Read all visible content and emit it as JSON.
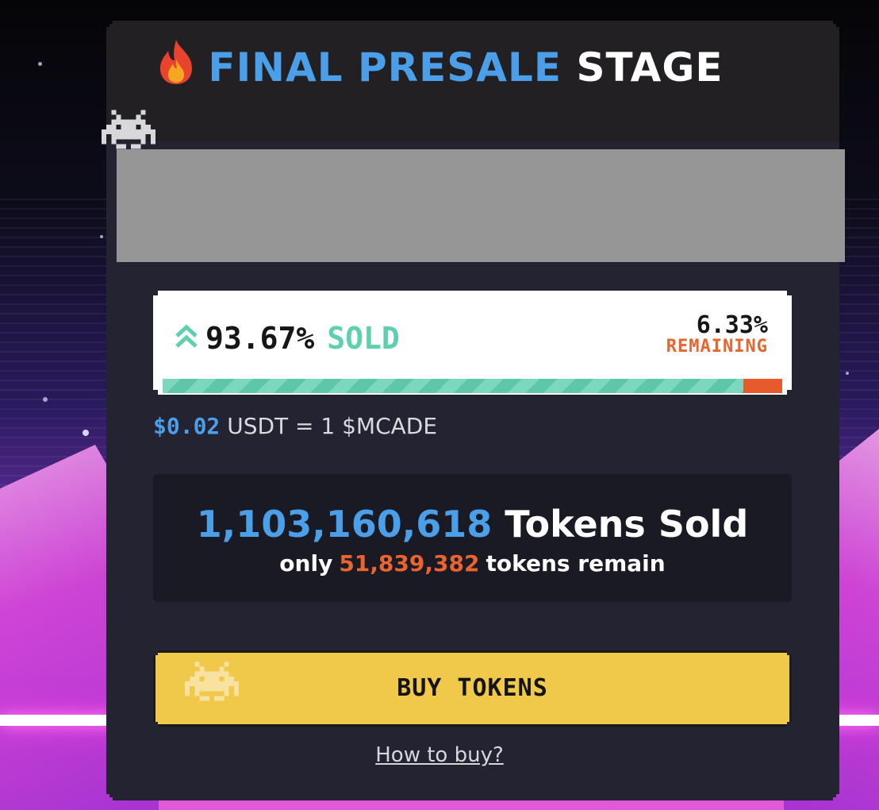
{
  "colors": {
    "accent_blue": "#4a9fe8",
    "sold_green": "#5ed0ad",
    "remaining_orange": "#ea6430",
    "button_yellow": "#f0c84a",
    "card_bg": "#232331"
  },
  "header": {
    "icon": "fire-icon",
    "title_highlight": "FINAL PRESALE",
    "title_rest": "STAGE"
  },
  "progress": {
    "sold_percent": "93.67%",
    "sold_label": "SOLD",
    "remaining_percent": "6.33%",
    "remaining_label": "REMAINING",
    "fill_fraction": 0.9367
  },
  "price": {
    "amount": "$0.02",
    "rest": "USDT = 1 $MCADE"
  },
  "tokens": {
    "sold_count": "1,103,160,618",
    "sold_label": "Tokens Sold",
    "remain_prefix": "only",
    "remain_count": "51,839,382",
    "remain_suffix": "tokens remain"
  },
  "actions": {
    "buy_label": "BUY TOKENS",
    "howto_label": "How to buy?"
  },
  "icons": [
    "fire-icon",
    "space-invader-icon",
    "chevron-double-up-icon"
  ]
}
